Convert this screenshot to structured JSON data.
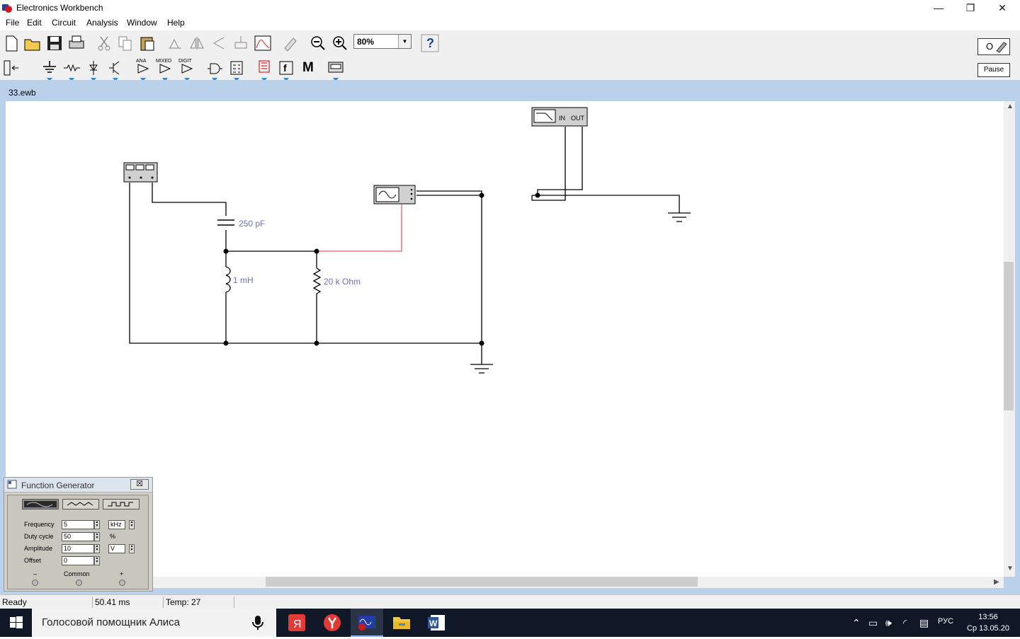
{
  "window": {
    "title": "Electronics Workbench",
    "minimize": "—",
    "restore": "❐",
    "close": "✕"
  },
  "menu": [
    "File",
    "Edit",
    "Circuit",
    "Analysis",
    "Window",
    "Help"
  ],
  "toolbar": {
    "zoom": "80%",
    "help_label": "?",
    "ana_label": "ANA",
    "mixed_label": "MIXED",
    "digit_label": "DIGIT",
    "m_label": "M",
    "f_label": "f",
    "power_label": "O",
    "pause_label": "Pause"
  },
  "document": {
    "title": "33.ewb"
  },
  "circuit": {
    "capacitor_label": "250 pF",
    "inductor_label": "1 mH",
    "resistor_label": "20 k Ohm",
    "bode_in_label": "IN",
    "bode_out_label": "OUT",
    "wire_color": "#000000",
    "probe_wire_color": "#e06060",
    "label_color": "#7070c0"
  },
  "function_generator": {
    "title": "Function Generator",
    "close": "☒",
    "frequency_label": "Frequency",
    "frequency_value": "5",
    "frequency_unit": "kHz",
    "duty_label": "Duty cycle",
    "duty_value": "50",
    "duty_unit": "%",
    "amplitude_label": "Amplitude",
    "amplitude_value": "10",
    "amplitude_unit": "V",
    "offset_label": "Offset",
    "offset_value": "0",
    "minus_label": "–",
    "common_label": "Common",
    "plus_label": "+"
  },
  "status": {
    "state": "Ready",
    "time": "50.41 ms",
    "temp": "Temp:  27"
  },
  "taskbar": {
    "search_text": "Голосовой помощник Алиса",
    "lang": "РУС",
    "time": "13:56",
    "date": "Ср 13.05.20"
  }
}
